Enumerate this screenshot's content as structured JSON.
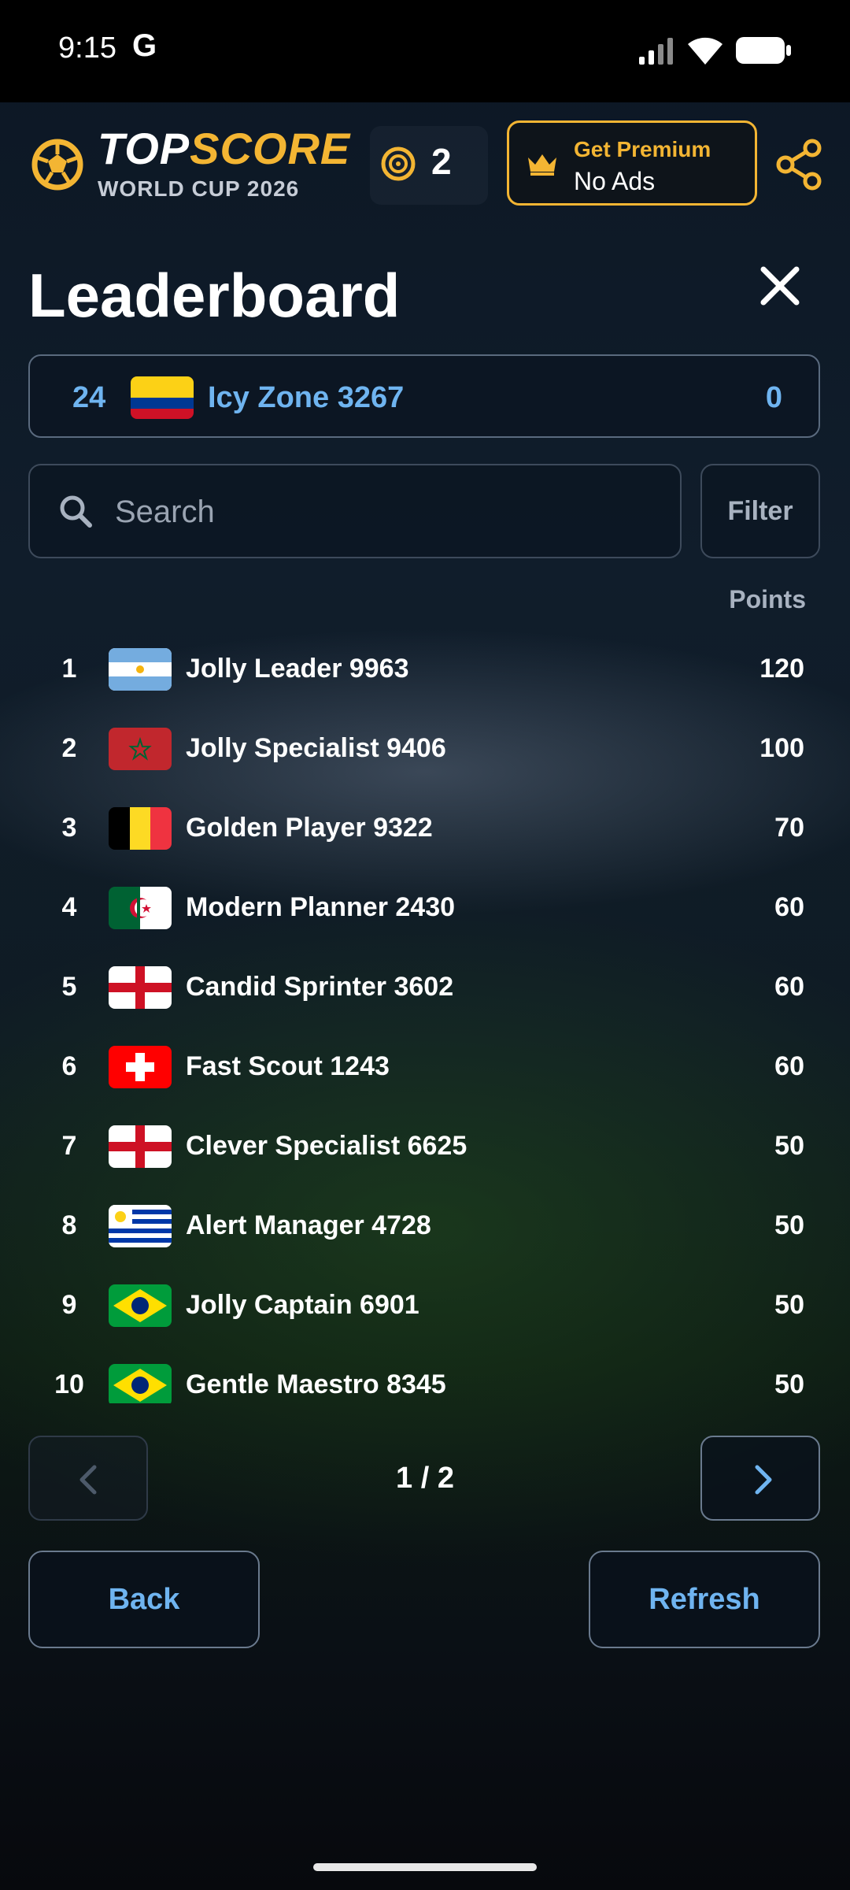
{
  "status_bar": {
    "time": "9:15",
    "g_badge": "G"
  },
  "header": {
    "brand_part1": "TOP",
    "brand_part2": "SCORE",
    "subtitle": "WORLD CUP 2026",
    "coins": "2",
    "premium_title": "Get Premium",
    "premium_sub": "No Ads",
    "accent_color": "#f3b533"
  },
  "page": {
    "title": "Leaderboard"
  },
  "my_entry": {
    "rank": "24",
    "flag": "colombia",
    "name": "Icy Zone 3267",
    "points": "0"
  },
  "search": {
    "placeholder": "Search",
    "value": ""
  },
  "filter_label": "Filter",
  "points_header": "Points",
  "leaderboard": [
    {
      "rank": "1",
      "flag": "argentina",
      "name": "Jolly Leader 9963",
      "points": "120"
    },
    {
      "rank": "2",
      "flag": "morocco",
      "name": "Jolly Specialist 9406",
      "points": "100"
    },
    {
      "rank": "3",
      "flag": "belgium",
      "name": "Golden Player 9322",
      "points": "70"
    },
    {
      "rank": "4",
      "flag": "algeria",
      "name": "Modern Planner 2430",
      "points": "60"
    },
    {
      "rank": "5",
      "flag": "england",
      "name": "Candid Sprinter 3602",
      "points": "60"
    },
    {
      "rank": "6",
      "flag": "switzerland",
      "name": "Fast Scout 1243",
      "points": "60"
    },
    {
      "rank": "7",
      "flag": "england",
      "name": "Clever Specialist 6625",
      "points": "50"
    },
    {
      "rank": "8",
      "flag": "uruguay",
      "name": "Alert Manager 4728",
      "points": "50"
    },
    {
      "rank": "9",
      "flag": "brazil",
      "name": "Jolly Captain 6901",
      "points": "50"
    },
    {
      "rank": "10",
      "flag": "brazil",
      "name": "Gentle Maestro 8345",
      "points": "50"
    }
  ],
  "pagination": {
    "indicator": "1 / 2",
    "prev_icon": "chevron-left-icon",
    "next_icon": "chevron-right-icon"
  },
  "buttons": {
    "back": "Back",
    "refresh": "Refresh"
  },
  "colors": {
    "link_blue": "#6fb4f0"
  }
}
